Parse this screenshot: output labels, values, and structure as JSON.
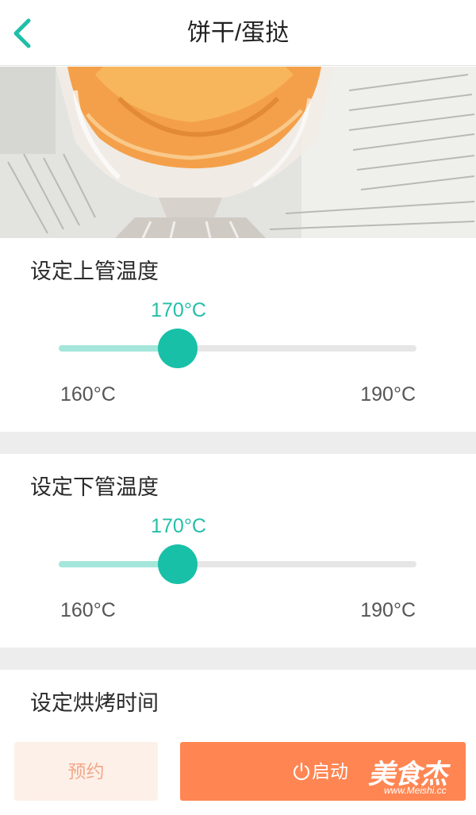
{
  "nav": {
    "title": "饼干/蛋挞"
  },
  "upper_temp": {
    "title": "设定上管温度",
    "value": "170°C",
    "min_label": "160°C",
    "max_label": "190°C",
    "value_fraction": 0.3333
  },
  "lower_temp": {
    "title": "设定下管温度",
    "value": "170°C",
    "min_label": "160°C",
    "max_label": "190°C",
    "value_fraction": 0.3333
  },
  "bake_time": {
    "title": "设定烘烤时间"
  },
  "actions": {
    "reserve_label": "预约",
    "start_label": "启动"
  },
  "watermark": {
    "brand": "美食杰",
    "url": "www.Meishi.cc"
  },
  "colors": {
    "accent": "#19c0a8",
    "track_fill": "#a5e6db",
    "start_button": "#ff8552",
    "reserve_button": "#fdf0e8"
  }
}
